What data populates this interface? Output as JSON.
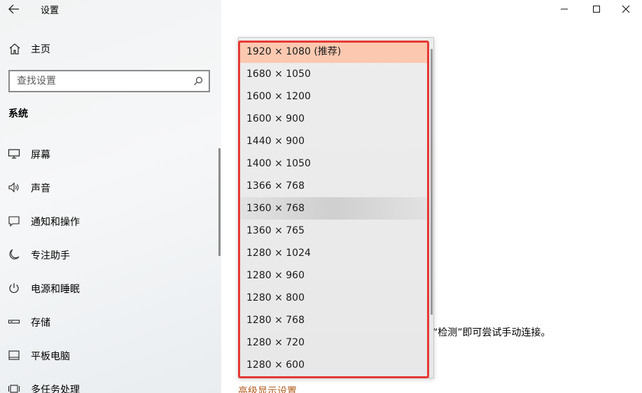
{
  "window": {
    "title": "设置",
    "back_icon": "arrow-left-icon",
    "controls": [
      "minimize-icon",
      "maximize-icon",
      "close-icon"
    ]
  },
  "sidebar": {
    "home_label": "主页",
    "search_placeholder": "查找设置",
    "section_title": "系统",
    "items": [
      {
        "label": "屏幕",
        "icon": "monitor-icon"
      },
      {
        "label": "声音",
        "icon": "speaker-icon"
      },
      {
        "label": "通知和操作",
        "icon": "notification-icon"
      },
      {
        "label": "专注助手",
        "icon": "moon-icon"
      },
      {
        "label": "电源和睡眠",
        "icon": "power-icon"
      },
      {
        "label": "存储",
        "icon": "storage-icon"
      },
      {
        "label": "平板电脑",
        "icon": "tablet-icon"
      },
      {
        "label": "多任务处理",
        "icon": "multitask-icon"
      }
    ]
  },
  "content": {
    "hint_text": "“检测”即可尝试手动连接。",
    "advanced_link": "高级显示设置"
  },
  "resolution_dropdown": {
    "options": [
      "1920 × 1080 (推荐)",
      "1680 × 1050",
      "1600 × 1200",
      "1600 × 900",
      "1440 × 900",
      "1400 × 1050",
      "1366 × 768",
      "1360 × 768",
      "1360 × 765",
      "1280 × 1024",
      "1280 × 960",
      "1280 × 800",
      "1280 × 768",
      "1280 × 720",
      "1280 × 600"
    ],
    "selected": "1920 × 1080 (推荐)",
    "hovered": "1360 × 768"
  },
  "colors": {
    "selected_bg": "#fcc9b0",
    "highlight_border": "#e53935",
    "link": "#b05a1a"
  }
}
